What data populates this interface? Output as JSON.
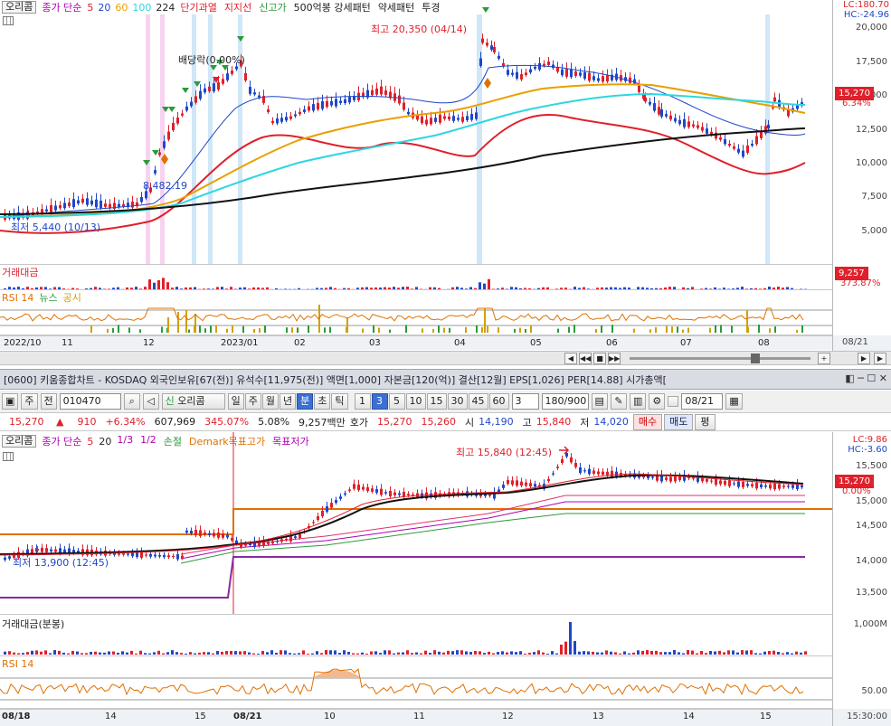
{
  "top": {
    "legend": {
      "stock": "오리콤",
      "ma_label": "종가 단순",
      "ma_periods": [
        {
          "label": "5",
          "color": "#e0202a"
        },
        {
          "label": "20",
          "color": "#1f47c8"
        },
        {
          "label": "60",
          "color": "#e8a000"
        },
        {
          "label": "100",
          "color": "#2fd6e0"
        },
        {
          "label": "224",
          "color": "#222222"
        }
      ],
      "signals": [
        {
          "label": "단기과열",
          "color": "#e0202a"
        },
        {
          "label": "지지선",
          "color": "#e0202a"
        },
        {
          "label": "신고가",
          "color": "#2a9a3a"
        },
        {
          "label": "500억봉 강세패턴",
          "color": "#222222"
        },
        {
          "label": "약세패턴",
          "color": "#222222"
        },
        {
          "label": "투경",
          "color": "#222222"
        }
      ]
    },
    "annotations": {
      "high": "최고 20,350 (04/14)",
      "dividend": "배당락(0.00%)",
      "low": "최저 5,440 (10/13)",
      "mid": "8,482.19"
    },
    "price_axis": [
      "20,000",
      "17,500",
      "15,000",
      "12,500",
      "10,000",
      "7,500",
      "5,000"
    ],
    "lc": "LC:180.70",
    "hc": "HC:-24.96",
    "last_price": "15,270",
    "last_pct": "6.34%",
    "volume_panel": {
      "label": "거래대금",
      "value": "9,257",
      "pct": "373.87%"
    },
    "rsi_panel": {
      "label": "RSI 14",
      "news": "뉴스",
      "notice": "공시"
    },
    "x_axis": [
      "2022/10",
      "11",
      "12",
      "2023/01",
      "02",
      "03",
      "04",
      "05",
      "06",
      "07",
      "08"
    ],
    "x_axis_right": "08/21"
  },
  "title_strip": "[0600] 키움종합차트 - KOSDAQ 외국인보유[67(전)] 유석수[11,975(전)] 액면[1,000] 자본금[120(억)] 결산[12월] EPS[1,026] PER[14.88] 시가총액[",
  "toolbar": {
    "period": "주",
    "prev": "전",
    "code": "010470",
    "stock_name": "오리콤",
    "intervals": [
      "일",
      "주",
      "월",
      "년",
      "분",
      "초",
      "틱"
    ],
    "active_interval": "분",
    "minutes": [
      "1",
      "3",
      "5",
      "10",
      "15",
      "30",
      "45",
      "60"
    ],
    "active_minute": "3",
    "count_select": "3",
    "range": "180/900",
    "date": "08/21"
  },
  "info": {
    "price": "15,270",
    "arrow": "▲",
    "change": "910",
    "change_pct": "+6.34%",
    "volume": "607,969",
    "volume_pct": "345.07%",
    "turnover_pct": "5.08%",
    "amount": "9,257백만",
    "quote_label": "호가",
    "ask": "15,270",
    "bid": "15,260",
    "open_label": "시",
    "open": "14,190",
    "high_label": "고",
    "high": "15,840",
    "low_label": "저",
    "low": "14,020",
    "buy": "매수",
    "sell": "매도",
    "avg": "평"
  },
  "bottom": {
    "legend": {
      "stock": "오리콤",
      "ma_label": "종가 단순",
      "ma_periods": [
        {
          "label": "5",
          "color": "#e0202a"
        },
        {
          "label": "20",
          "color": "#222222"
        }
      ],
      "extra": [
        {
          "label": "1/3",
          "color": "#b000b0"
        },
        {
          "label": "1/2",
          "color": "#b000b0"
        },
        {
          "label": "손절",
          "color": "#2a9a3a"
        },
        {
          "label": "Demark목표고가",
          "color": "#e07000"
        },
        {
          "label": "목표저가",
          "color": "#b000b0"
        }
      ]
    },
    "annotations": {
      "high": "최고 15,840 (12:45)",
      "low": "최저 13,900 (12:45)"
    },
    "price_axis": [
      "15,500",
      "15,000",
      "14,500",
      "14,000",
      "13,500"
    ],
    "lc": "LC:9.86",
    "hc": "HC:-3.60",
    "last_price": "15,270",
    "last_pct": "0.00%",
    "volume_panel": {
      "label": "거래대금(분봉)",
      "axis": "1,000M"
    },
    "rsi_panel": {
      "label": "RSI 14",
      "axis": "50.00"
    },
    "x_axis": [
      "08/18",
      "14",
      "15",
      "08/21",
      "10",
      "11",
      "12",
      "13",
      "14",
      "15"
    ],
    "x_axis_right": "15:30:00"
  },
  "colors": {
    "up": "#e0202a",
    "down": "#1f47c8",
    "highlight_blue": "#cfe7f7",
    "highlight_pink": "#f7d3ef"
  }
}
